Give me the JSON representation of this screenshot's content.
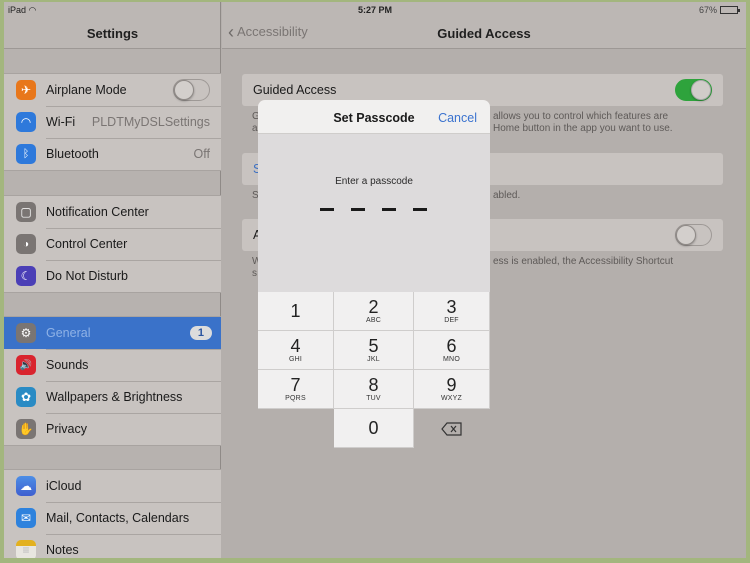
{
  "status_bar": {
    "device": "iPad",
    "wifi_icon": "wifi-icon",
    "time": "5:27 PM",
    "battery_percent": "67%",
    "battery_level": 0.67
  },
  "left_panel": {
    "title": "Settings",
    "groups": [
      {
        "items": [
          {
            "label": "Airplane Mode",
            "icon": "airplane-icon",
            "icon_color": "#e8771b",
            "toggle": false
          },
          {
            "label": "Wi-Fi",
            "icon": "wifi-icon",
            "icon_color": "#2e79db",
            "value": "PLDTMyDSLSettings"
          },
          {
            "label": "Bluetooth",
            "icon": "bluetooth-icon",
            "icon_color": "#2e79db",
            "value": "Off"
          }
        ]
      },
      {
        "items": [
          {
            "label": "Notification Center",
            "icon": "notification-center-icon",
            "icon_color": "#7a7573"
          },
          {
            "label": "Control Center",
            "icon": "control-center-icon",
            "icon_color": "#7a7573"
          },
          {
            "label": "Do Not Disturb",
            "icon": "moon-icon",
            "icon_color": "#4b3fb6"
          }
        ]
      },
      {
        "items": [
          {
            "label": "General",
            "icon": "gear-icon",
            "icon_color": "#7a7573",
            "badge": "1",
            "selected": true
          },
          {
            "label": "Sounds",
            "icon": "speaker-icon",
            "icon_color": "#d9242e"
          },
          {
            "label": "Wallpapers & Brightness",
            "icon": "flower-icon",
            "icon_color": "#2a8bc4"
          },
          {
            "label": "Privacy",
            "icon": "hand-icon",
            "icon_color": "#7a7573"
          }
        ]
      },
      {
        "items": [
          {
            "label": "iCloud",
            "icon": "cloud-icon",
            "icon_color": "#3f7fdc"
          },
          {
            "label": "Mail, Contacts, Calendars",
            "icon": "mail-icon",
            "icon_color": "#2e82dd"
          },
          {
            "label": "Notes",
            "icon": "notes-icon",
            "icon_color": "#e3b11f"
          }
        ]
      }
    ]
  },
  "right_panel": {
    "back_label": "Accessibility",
    "title": "Guided Access",
    "guided_access": {
      "label": "Guided Access",
      "toggle": true,
      "footer_line1_left": "G",
      "footer_line1_right": "allows you to control which features are",
      "footer_line2_left": "a",
      "footer_line2_right": "Home button in the app you want to use."
    },
    "set_passcode_row": {
      "label_partial": "S",
      "footer_left": "S",
      "footer_right": "abled."
    },
    "accessibility_shortcut": {
      "label_partial": "A",
      "toggle": false,
      "footer_line1_left": "W",
      "footer_line1_right": "ess is enabled, the Accessibility Shortcut",
      "footer_line2_left": "s"
    }
  },
  "modal": {
    "title": "Set Passcode",
    "cancel_label": "Cancel",
    "prompt": "Enter a passcode",
    "digits_entered": 0,
    "digits_total": 4,
    "keys": [
      {
        "num": "1",
        "letters": ""
      },
      {
        "num": "2",
        "letters": "ABC"
      },
      {
        "num": "3",
        "letters": "DEF"
      },
      {
        "num": "4",
        "letters": "GHI"
      },
      {
        "num": "5",
        "letters": "JKL"
      },
      {
        "num": "6",
        "letters": "MNO"
      },
      {
        "num": "7",
        "letters": "PQRS"
      },
      {
        "num": "8",
        "letters": "TUV"
      },
      {
        "num": "9",
        "letters": "WXYZ"
      },
      {
        "num": "",
        "letters": ""
      },
      {
        "num": "0",
        "letters": ""
      },
      {
        "num": "delete",
        "letters": ""
      }
    ]
  }
}
